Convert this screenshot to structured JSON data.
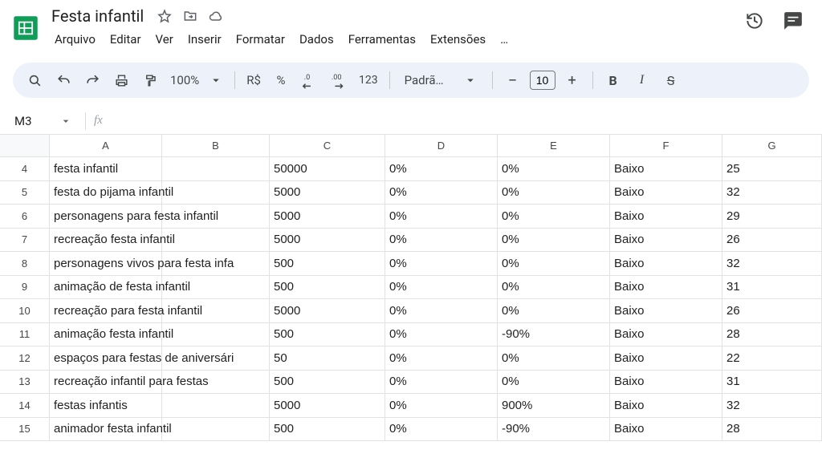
{
  "header": {
    "title": "Festa infantil",
    "menus": [
      "Arquivo",
      "Editar",
      "Ver",
      "Inserir",
      "Formatar",
      "Dados",
      "Ferramentas",
      "Extensões",
      "…"
    ]
  },
  "toolbar": {
    "zoom": "100%",
    "currency": "R$",
    "percent": "%",
    "dec_decrease": ".0",
    "dec_increase": ".00",
    "number_format": "123",
    "font": "Padrã…",
    "font_size": "10"
  },
  "namebox": {
    "cell": "M3",
    "fx_label": "fx",
    "formula": ""
  },
  "columns": [
    "A",
    "B",
    "C",
    "D",
    "E",
    "F",
    "G"
  ],
  "col_widths": [
    "wA",
    "wB",
    "wC",
    "wD",
    "wE",
    "wF",
    "wG"
  ],
  "rows": [
    {
      "n": "4",
      "cells": [
        "festa infantil",
        "",
        "50000",
        "0%",
        "0%",
        "Baixo",
        "25"
      ]
    },
    {
      "n": "5",
      "cells": [
        "festa do pijama infantil",
        "",
        "5000",
        "0%",
        "0%",
        "Baixo",
        "32"
      ]
    },
    {
      "n": "6",
      "cells": [
        "personagens para festa infantil",
        "",
        "5000",
        "0%",
        "0%",
        "Baixo",
        "29"
      ]
    },
    {
      "n": "7",
      "cells": [
        "recreação festa infantil",
        "",
        "5000",
        "0%",
        "0%",
        "Baixo",
        "26"
      ]
    },
    {
      "n": "8",
      "cells": [
        "personagens vivos para festa infa",
        "",
        "500",
        "0%",
        "0%",
        "Baixo",
        "32"
      ]
    },
    {
      "n": "9",
      "cells": [
        "animação de festa infantil",
        "",
        "500",
        "0%",
        "0%",
        "Baixo",
        "31"
      ]
    },
    {
      "n": "10",
      "cells": [
        "recreação para festa infantil",
        "",
        "5000",
        "0%",
        "0%",
        "Baixo",
        "26"
      ]
    },
    {
      "n": "11",
      "cells": [
        "animação festa infantil",
        "",
        "500",
        "0%",
        "-90%",
        "Baixo",
        "28"
      ]
    },
    {
      "n": "12",
      "cells": [
        "espaços para festas de aniversári",
        "",
        "50",
        "0%",
        "0%",
        "Baixo",
        "22"
      ]
    },
    {
      "n": "13",
      "cells": [
        "recreação infantil para festas",
        "",
        "500",
        "0%",
        "0%",
        "Baixo",
        "31"
      ]
    },
    {
      "n": "14",
      "cells": [
        "festas infantis",
        "",
        "5000",
        "0%",
        "900%",
        "Baixo",
        "32"
      ]
    },
    {
      "n": "15",
      "cells": [
        "animador festa infantil",
        "",
        "500",
        "0%",
        "-90%",
        "Baixo",
        "28"
      ]
    }
  ]
}
